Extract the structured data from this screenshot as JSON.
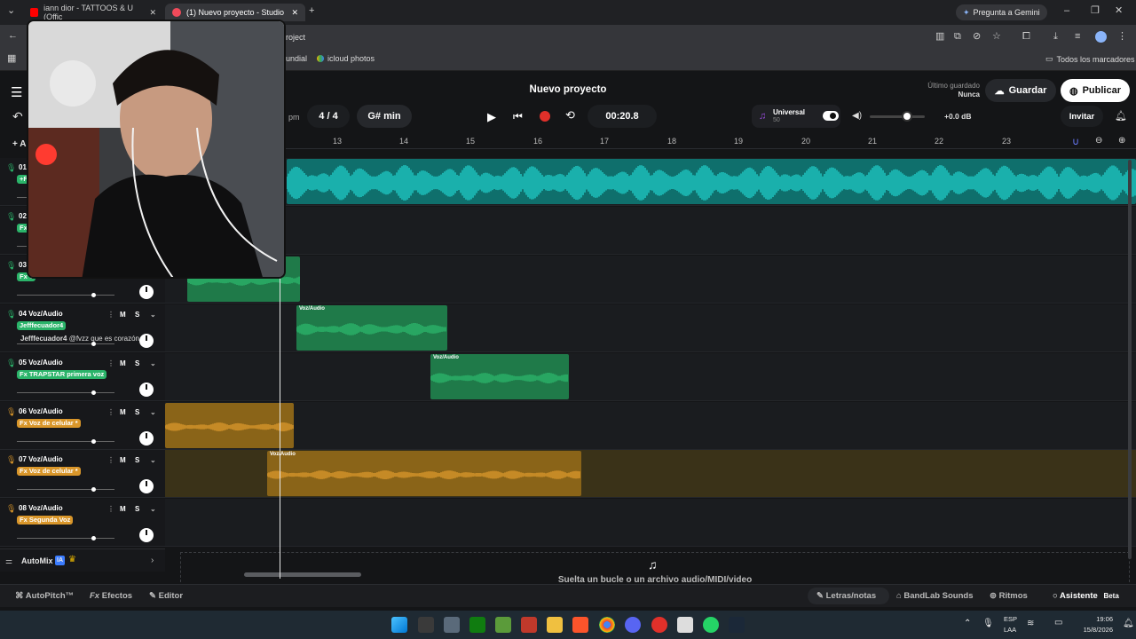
{
  "browser": {
    "tabs": [
      {
        "label": "iann dior - TATTOOS & U (Offic",
        "color": "#ff0000"
      },
      {
        "label": "(1) Nuevo proyecto - Studio",
        "color": "#f04a5a"
      }
    ],
    "address": "roject",
    "gemini": "Pregunta a Gemini",
    "bookmarks": [
      "undial",
      "icloud photos"
    ],
    "all_bookmarks": "Todos los marcadores"
  },
  "app": {
    "project_title": "Nuevo proyecto",
    "last_saved_label": "Último guardado",
    "last_saved_value": "Nunca",
    "save_button": "Guardar",
    "publish_button": "Publicar",
    "invite_button": "Invitar",
    "bpm_unit": "pm",
    "time_signature": "4 / 4",
    "key": "G# min",
    "time": "00:20.8",
    "preset_name": "Universal",
    "preset_value": "50",
    "gain": "+0.0 dB",
    "add_track_label": "+ A"
  },
  "ruler": [
    "13",
    "14",
    "15",
    "16",
    "17",
    "18",
    "19",
    "20",
    "21",
    "22",
    "23"
  ],
  "tracks": [
    {
      "num": "01",
      "name": "",
      "fx": "+F",
      "fx_color": "green"
    },
    {
      "num": "02",
      "name": "",
      "fx": "Fx",
      "fx_color": "green"
    },
    {
      "num": "03",
      "name": "",
      "fx": "Fx T",
      "fx_color": "green"
    },
    {
      "num": "04",
      "name": "Voz/Audio",
      "fx": "Jefffecuador4",
      "fx_color": "green",
      "chat": "Jefffecuador4",
      "chat_text": "@fvzz que es corazón"
    },
    {
      "num": "05",
      "name": "Voz/Audio",
      "fx": "Fx TRAPSTAR primera voz",
      "fx_color": "green"
    },
    {
      "num": "06",
      "name": "Voz/Audio",
      "fx": "Fx Voz de celular *",
      "fx_color": "orange"
    },
    {
      "num": "07",
      "name": "Voz/Audio",
      "fx": "Fx Voz de celular *",
      "fx_color": "orange"
    },
    {
      "num": "08",
      "name": "Voz/Audio",
      "fx": "Fx Segunda Voz",
      "fx_color": "orange"
    }
  ],
  "mute_label": "M",
  "solo_label": "S",
  "clip_label": "Voz/Audio",
  "automix": "AutoMix",
  "automix_badge": "IA",
  "drop_hint": "Suelta un bucle o un archivo audio/MIDI/video",
  "bottom": {
    "autopitch": "AutoPitch™",
    "effects": "Efectos",
    "editor": "Editor",
    "lyrics": "Letras/notas",
    "sounds": "BandLab Sounds",
    "beats": "Ritmos",
    "assistant": "Asistente",
    "beta": "Beta"
  },
  "taskbar": {
    "lang": "ESP",
    "lang2": "LAA",
    "time": "19:06",
    "date": "15/8/2026"
  },
  "colors": {
    "teal": "#1fc6c1",
    "green": "#2bb46a",
    "orange": "#d9962a",
    "record": "#e0302a"
  }
}
